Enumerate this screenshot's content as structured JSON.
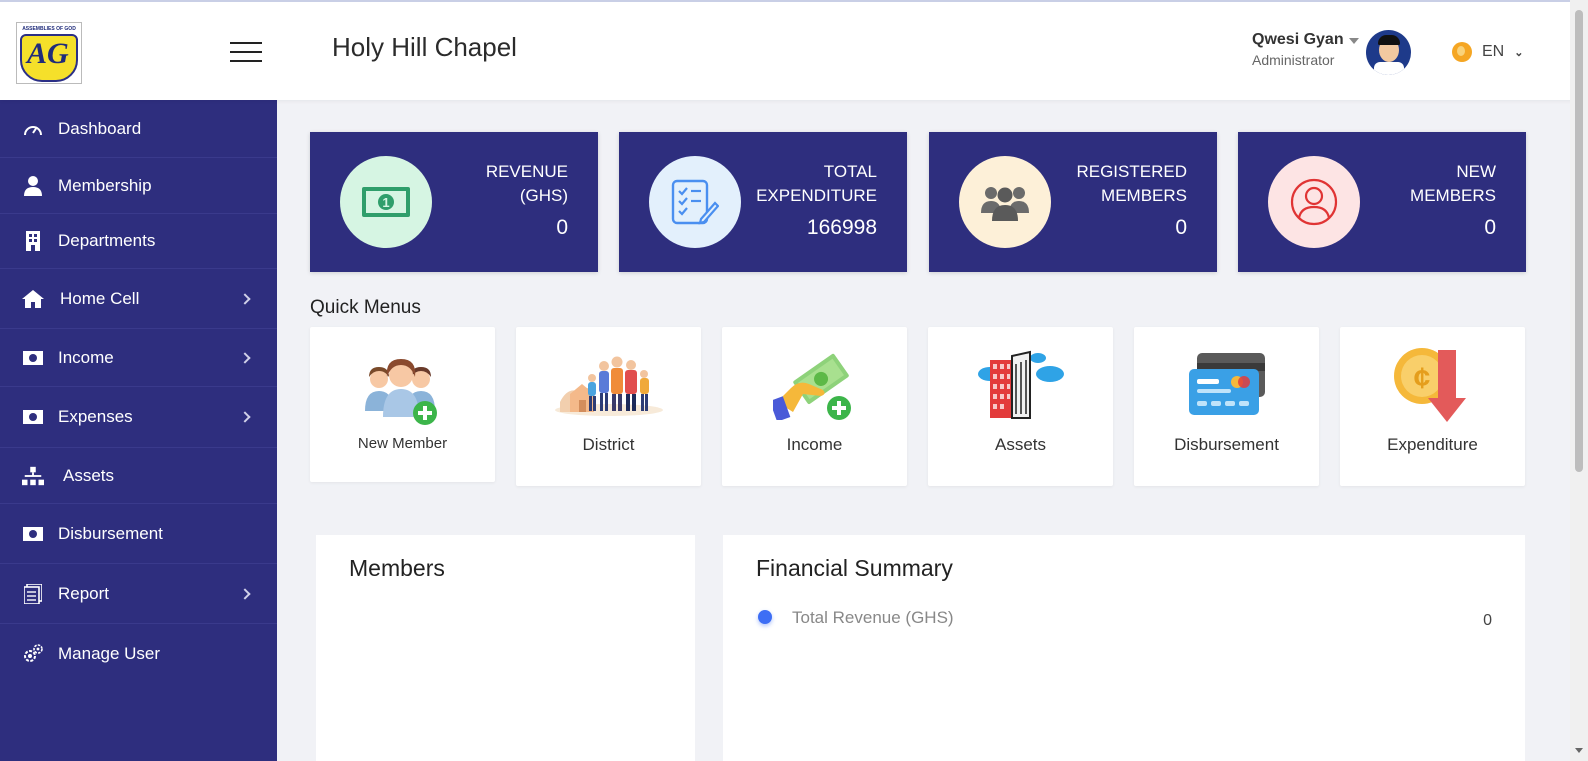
{
  "header": {
    "logo_text": "ASSEMBLIES OF GOD",
    "logo_letters": "AG",
    "title": "Holy Hill Chapel",
    "user_name": "Qwesi Gyan",
    "user_role": "Administrator",
    "language": "EN"
  },
  "sidebar": {
    "items": [
      {
        "label": "Dashboard",
        "icon": "speedometer-icon"
      },
      {
        "label": "Membership",
        "icon": "user-icon"
      },
      {
        "label": "Departments",
        "icon": "building-icon"
      },
      {
        "label": "Home Cell",
        "icon": "home-icon",
        "has_submenu": true
      },
      {
        "label": "Income",
        "icon": "money-icon",
        "has_submenu": true
      },
      {
        "label": "Expenses",
        "icon": "money-icon",
        "has_submenu": true
      },
      {
        "label": "Assets",
        "icon": "sitemap-icon"
      },
      {
        "label": "Disbursement",
        "icon": "money-icon"
      },
      {
        "label": "Report",
        "icon": "report-icon",
        "has_submenu": true
      },
      {
        "label": "Manage User",
        "icon": "gears-icon"
      }
    ]
  },
  "stats": [
    {
      "label": "REVENUE\n(GHS)",
      "value": "0",
      "icon": "cash-icon",
      "circle_color": "#d6f5e3"
    },
    {
      "label": "TOTAL\nEXPENDITURE",
      "value": "166998",
      "icon": "checklist-icon",
      "circle_color": "#e3f0fc"
    },
    {
      "label": "REGISTERED\nMEMBERS",
      "value": "0",
      "icon": "group-icon",
      "circle_color": "#fdf0d8"
    },
    {
      "label": "NEW\nMEMBERS",
      "value": "0",
      "icon": "user-circle-icon",
      "circle_color": "#fde4e4"
    }
  ],
  "quick_menus": {
    "title": "Quick Menus",
    "items": [
      {
        "label": "New Member",
        "icon": "add-member-icon"
      },
      {
        "label": "District",
        "icon": "family-icon"
      },
      {
        "label": "Income",
        "icon": "cash-hand-icon"
      },
      {
        "label": "Assets",
        "icon": "buildings-icon"
      },
      {
        "label": "Disbursement",
        "icon": "credit-card-icon"
      },
      {
        "label": "Expenditure",
        "icon": "coin-down-icon"
      }
    ]
  },
  "members_panel": {
    "title": "Members"
  },
  "financial_panel": {
    "title": "Financial Summary",
    "legend_label": "Total Revenue (GHS)",
    "legend_value": "0",
    "legend_color": "#3d6ef5"
  },
  "colors": {
    "sidebar": "#2e2e7e",
    "accent": "#2e2e7e"
  }
}
